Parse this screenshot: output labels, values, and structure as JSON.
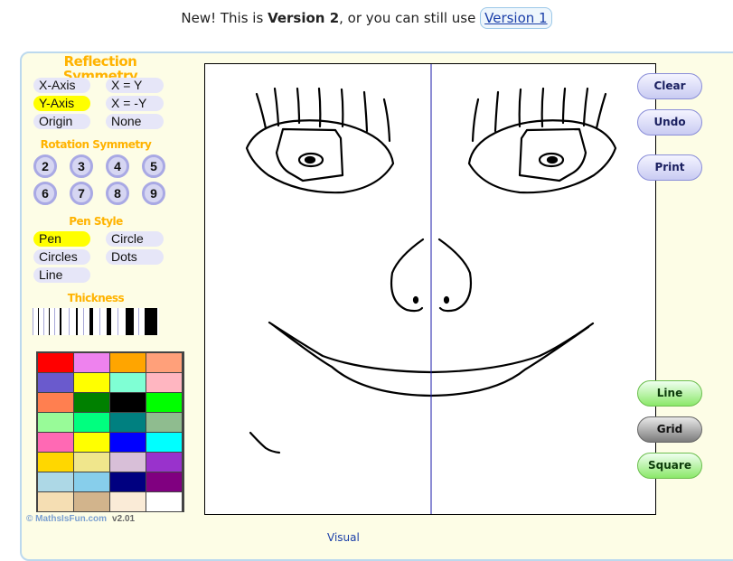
{
  "notice": {
    "prefix": "New! This is ",
    "version": "Version 2",
    "middle": ", or you can still use ",
    "link": "Version 1"
  },
  "reflection": {
    "title": "Reflection Symmetry",
    "options": [
      "X-Axis",
      "X = Y",
      "Y-Axis",
      "X = -Y",
      "Origin",
      "None"
    ],
    "selected": "Y-Axis"
  },
  "rotation": {
    "title": "Rotation Symmetry",
    "options": [
      "2",
      "3",
      "4",
      "5",
      "6",
      "7",
      "8",
      "9"
    ]
  },
  "pen": {
    "title": "Pen Style",
    "options": [
      "Pen",
      "Circle",
      "Circles",
      "Dots",
      "Line"
    ],
    "selected": "Pen"
  },
  "thickness": {
    "title": "Thickness"
  },
  "palette": {
    "colors": [
      "#ff0000",
      "#ee82ee",
      "#ffa500",
      "#ffa07a",
      "#6a5acd",
      "#ffff00",
      "#7fffd4",
      "#ffb6c1",
      "#ff7f50",
      "#008000",
      "#000000",
      "#00ff00",
      "#98fb98",
      "#00ff7f",
      "#008080",
      "#8fbc8f",
      "#ff69b4",
      "#ffff00",
      "#0000ff",
      "#00ffff",
      "#ffd700",
      "#f0e68c",
      "#d8bfd8",
      "#9932cc",
      "#add8e6",
      "#87ceeb",
      "#000080",
      "#800080",
      "#f5deb3",
      "#d2b48c",
      "#faebd7",
      "#ffffff"
    ]
  },
  "buttons": {
    "clear": "Clear",
    "undo": "Undo",
    "print": "Print",
    "line": "Line",
    "grid": "Grid",
    "square": "Square"
  },
  "footer": {
    "brand": "© MathsIsFun.com",
    "version": "v2.01"
  },
  "bottom_text": "Visual"
}
